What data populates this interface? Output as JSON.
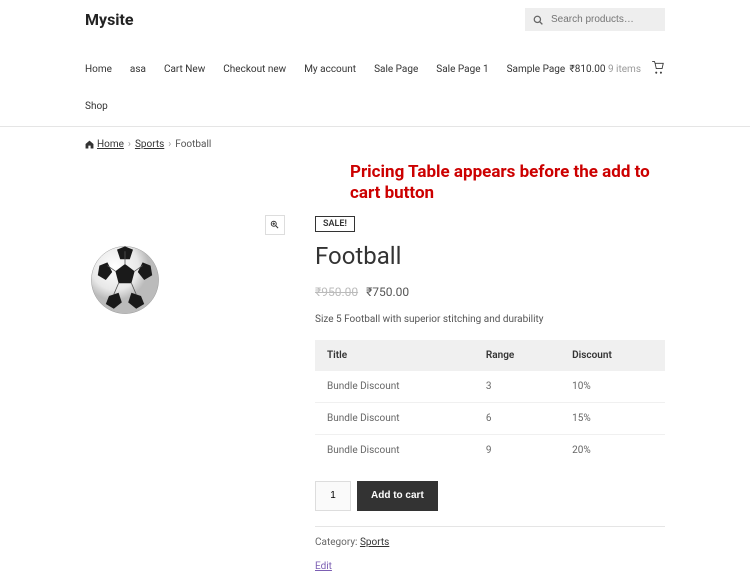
{
  "site": {
    "title": "Mysite"
  },
  "search": {
    "placeholder": "Search products…"
  },
  "nav": {
    "items": [
      "Home",
      "asa",
      "Cart New",
      "Checkout new",
      "My account",
      "Sale Page",
      "Sale Page 1",
      "Sample Page"
    ],
    "secondary": [
      "Shop"
    ],
    "cart_total": "₹810.00",
    "cart_items": "9 items"
  },
  "breadcrumb": {
    "home": "Home",
    "category": "Sports",
    "current": "Football"
  },
  "annotation": "Pricing Table appears before the add to cart button",
  "product": {
    "sale_badge": "SALE!",
    "title": "Football",
    "old_price": "₹950.00",
    "new_price": "₹750.00",
    "description": "Size 5 Football with superior stitching and durability",
    "qty": "1",
    "add_to_cart": "Add to cart",
    "category_label": "Category:",
    "category_value": "Sports",
    "edit": "Edit"
  },
  "pricing_table": {
    "headers": [
      "Title",
      "Range",
      "Discount"
    ],
    "rows": [
      {
        "title": "Bundle Discount",
        "range": "3",
        "discount": "10%"
      },
      {
        "title": "Bundle Discount",
        "range": "6",
        "discount": "15%"
      },
      {
        "title": "Bundle Discount",
        "range": "9",
        "discount": "20%"
      }
    ]
  }
}
